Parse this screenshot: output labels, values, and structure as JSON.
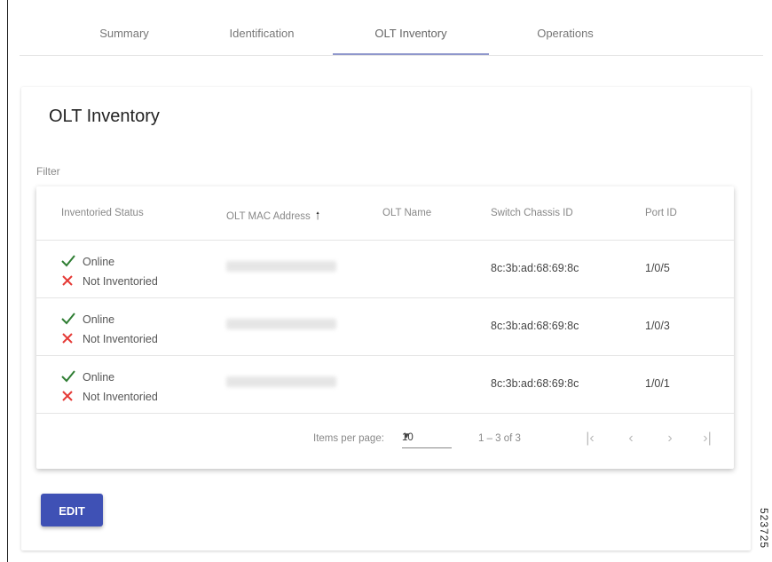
{
  "tabs": [
    {
      "label": "Summary"
    },
    {
      "label": "Identification"
    },
    {
      "label": "OLT Inventory"
    },
    {
      "label": "Operations"
    }
  ],
  "card": {
    "title": "OLT Inventory",
    "filter_label": "Filter"
  },
  "table": {
    "columns": [
      "Inventoried Status",
      "OLT MAC Address",
      "OLT Name",
      "Switch Chassis ID",
      "Port ID"
    ],
    "sort_icon": "arrow-up-icon",
    "rows": [
      {
        "status_online": "Online",
        "status_inventory": "Not Inventoried",
        "olt_name": "",
        "switch_chassis_id": "8c:3b:ad:68:69:8c",
        "port_id": "1/0/5"
      },
      {
        "status_online": "Online",
        "status_inventory": "Not Inventoried",
        "olt_name": "",
        "switch_chassis_id": "8c:3b:ad:68:69:8c",
        "port_id": "1/0/3"
      },
      {
        "status_online": "Online",
        "status_inventory": "Not Inventoried",
        "olt_name": "",
        "switch_chassis_id": "8c:3b:ad:68:69:8c",
        "port_id": "1/0/1"
      }
    ]
  },
  "pager": {
    "items_per_page_label": "Items per page:",
    "items_per_page_value": "10",
    "range_label": "1 – 3 of 3"
  },
  "actions": {
    "edit_label": "EDIT"
  },
  "figure_id": "523725",
  "colors": {
    "accent": "#3f51b5",
    "tab_ink": "#8f97cc",
    "online": "#2e7d32",
    "not_inventoried": "#e53935"
  }
}
